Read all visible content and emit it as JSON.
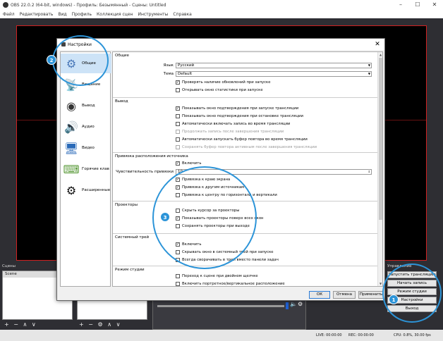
{
  "obs": {
    "title": "OBS 22.0.2 (64-bit, windows) - Профиль: Безымянный - Сцены: Untitled",
    "menu": [
      "Файл",
      "Редактировать",
      "Вид",
      "Профиль",
      "Коллекция сцен",
      "Инструменты",
      "Справка"
    ],
    "docks": {
      "scenes_label": "Сцены",
      "scenes_header": "Scene",
      "controls_label": "Управление"
    },
    "controls": [
      "Запустить трансляцию",
      "Начать запись",
      "Режим студии",
      "Настройки",
      "Выход"
    ],
    "status": {
      "live": "LIVE: 00:00:00",
      "rec": "REC: 00:00:00",
      "cpu": "CPU: 0.8%, 30.00 fps"
    }
  },
  "dialog": {
    "title": "Настройки",
    "sidebar": [
      "Общие",
      "Вещание",
      "Вывод",
      "Аудио",
      "Видео",
      "Горячие клав",
      "Расширенные"
    ],
    "general": {
      "group": "Общие",
      "language_label": "Язык",
      "language_value": "Русский",
      "theme_label": "Тема",
      "theme_value": "Default",
      "check_updates": "Проверять наличие обновлений при запуске",
      "open_stats": "Открывать окно статистики при запуске"
    },
    "output": {
      "group": "Вывод",
      "confirm_start": "Показывать окно подтверждения при запуске трансляции",
      "confirm_stop": "Показывать окно подтверждения при остановке трансляции",
      "auto_record": "Автоматически включать запись во время трансляции",
      "keep_recording": "Продолжать запись после завершения трансляции",
      "auto_replay": "Автоматически запускать буфер повтора во время трансляции",
      "keep_replay": "Сохранять буфер повтора активным после завершения трансляции"
    },
    "snapping": {
      "group": "Привязка расположения источника",
      "enable": "Включить",
      "sensitivity_label": "Чувствительность привязки",
      "sensitivity_value": "10",
      "screen_edge": "Привязка к краю экрана",
      "other_sources": "Привязка к другим источникам",
      "center": "Привязка к центру по горизонтали и вертикали"
    },
    "projectors": {
      "group": "Проекторы",
      "hide_cursor": "Скрыть курсор за проекторы",
      "always_on_top": "Показывать проекторы поверх всех окон",
      "save_on_exit": "Сохранять проекторы при выходе"
    },
    "tray": {
      "group": "Системный трей",
      "enable": "Включить",
      "minimize_start": "Скрывать окно в системный трей при запуске",
      "always_minimize": "Всегда сворачивать в трей вместо панели задач"
    },
    "studio": {
      "group": "Режим студии",
      "double_click": "Переход к сцене при двойном щелчке",
      "portrait": "Включить портретное/вертикальное расположение"
    },
    "buttons": {
      "ok": "ОК",
      "cancel": "Отмена",
      "apply": "Применить"
    }
  },
  "callouts": [
    "1",
    "2",
    "3"
  ],
  "colors": {
    "accent": "#2c94d8",
    "preview_border": "#d02020"
  },
  "icons": [
    "gear-icon",
    "satellite-dish-icon",
    "globe-icon",
    "speaker-icon",
    "monitor-icon",
    "keyboard-icon",
    "gears-icon"
  ]
}
